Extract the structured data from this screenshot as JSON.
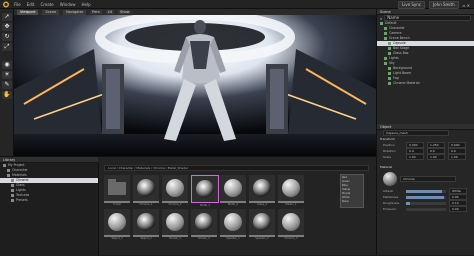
{
  "menu": [
    "File",
    "Edit",
    "Create",
    "Window",
    "Help"
  ],
  "user": {
    "mode": "Live Sync",
    "name": "John Smith"
  },
  "viewport": {
    "tabs": [
      "Viewport",
      "Scene",
      "Navigator"
    ],
    "toolbar": [
      "Pers",
      "Lit",
      "Show"
    ]
  },
  "left_tools": [
    "arrow-icon",
    "move-icon",
    "rotate-icon",
    "scale-icon",
    "camera-icon",
    "light-icon",
    "paint-icon",
    "hand-icon"
  ],
  "scene": {
    "header": "Scene",
    "filter_placeholder": "Name",
    "rows": [
      {
        "label": "Default",
        "sel": false,
        "indent": 0
      },
      {
        "label": "Character",
        "sel": false,
        "indent": 1
      },
      {
        "label": "Camera",
        "sel": false,
        "indent": 1
      },
      {
        "label": "Scene Bench",
        "sel": false,
        "indent": 1
      },
      {
        "label": "Capsule",
        "sel": true,
        "indent": 2
      },
      {
        "label": "Ball Stage",
        "sel": false,
        "indent": 2
      },
      {
        "label": "Glass Box",
        "sel": false,
        "indent": 2
      },
      {
        "label": "Lights",
        "sel": false,
        "indent": 1
      },
      {
        "label": "Sky",
        "sel": false,
        "indent": 1
      },
      {
        "label": "Background",
        "sel": false,
        "indent": 2
      },
      {
        "label": "Light Beam",
        "sel": false,
        "indent": 2
      },
      {
        "label": "Fog",
        "sel": false,
        "indent": 2
      },
      {
        "label": "Chrome Material",
        "sel": false,
        "indent": 2
      }
    ]
  },
  "properties": {
    "header": "Object",
    "name_field": "Capsule_mesh",
    "transform_header": "Transform",
    "transform": [
      {
        "label": "Position",
        "x": "0.000",
        "y": "1.250",
        "z": "0.000"
      },
      {
        "label": "Rotation",
        "x": "0.0",
        "y": "0.0",
        "z": "0.0"
      },
      {
        "label": "Scale",
        "x": "1.00",
        "y": "1.00",
        "z": "1.00"
      }
    ],
    "material_header": "Material",
    "material_name": "Chrome",
    "material_rows": [
      {
        "label": "Albedo",
        "value": "White",
        "fill": 0.9
      },
      {
        "label": "Metalness",
        "value": "0.95",
        "fill": 0.95
      },
      {
        "label": "Roughness",
        "value": "0.10",
        "fill": 0.1
      },
      {
        "label": "Emission",
        "value": "0.00",
        "fill": 0.0
      }
    ]
  },
  "assets": {
    "header": "Library",
    "path": "Local / Character / Materials / Chrome / Metal_Shader",
    "tree": [
      "My Project",
      "Character",
      "Materials",
      "Chrome",
      "Glass",
      "Lights",
      "Textures",
      "Presets"
    ],
    "row1": [
      {
        "type": "folder",
        "label": "Folder"
      },
      {
        "type": "sphere",
        "label": "Chrome_1"
      },
      {
        "type": "sphere",
        "label": "Chrome_2"
      },
      {
        "type": "sphere",
        "label": "Metal_1"
      },
      {
        "type": "sphere",
        "label": "Metal_2"
      },
      {
        "type": "sphere",
        "label": "Glass_1"
      },
      {
        "type": "sphere",
        "label": "Plastic_1"
      }
    ],
    "row2": [
      {
        "type": "sphere",
        "label": "Teapot_1"
      },
      {
        "type": "sphere",
        "label": "Teapot_2"
      },
      {
        "type": "sphere",
        "label": "Shader_1"
      },
      {
        "type": "sphere",
        "label": "Shader_2"
      },
      {
        "type": "sphere",
        "label": "Speaker_1"
      },
      {
        "type": "sphere",
        "label": "Speaker_2"
      },
      {
        "type": "sphere",
        "label": "Chrome_3"
      }
    ],
    "popup": [
      "Red",
      "Green",
      "Blue",
      "Yellow",
      "Purple",
      "White",
      "None"
    ]
  },
  "colors": {
    "accent": "#6d8fb4",
    "selection": "#d7dbdf",
    "tag": "#d26bd6"
  }
}
